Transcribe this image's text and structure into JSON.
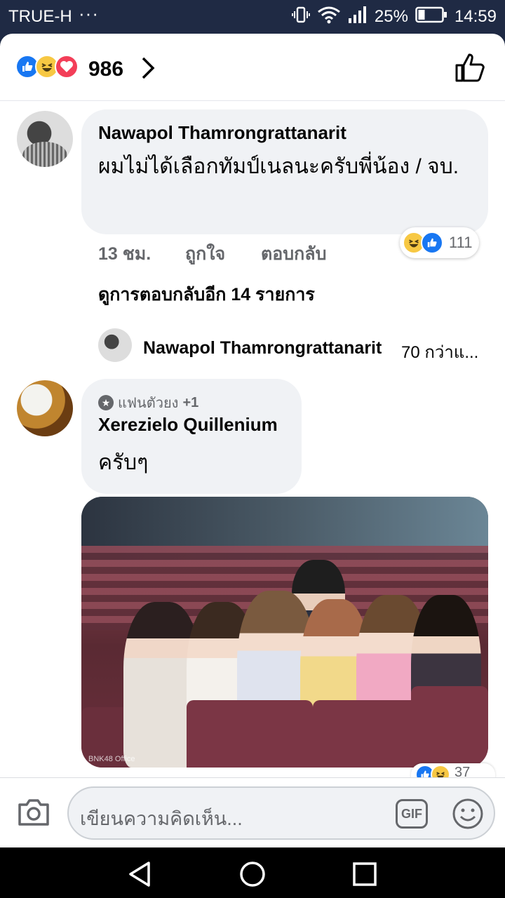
{
  "status_bar": {
    "carrier": "TRUE-H",
    "dots": "···",
    "battery": "25%",
    "time": "14:59"
  },
  "reactions_header": {
    "total": "986",
    "icons": [
      "like-icon",
      "haha-icon",
      "love-icon"
    ]
  },
  "comments": [
    {
      "author": "Nawapol Thamrongrattanarit",
      "text": "ผมไม่ได้เลือกทัมป์เนลนะครับพี่น้อง / จบ.",
      "time": "13 ชม.",
      "like_label": "ถูกใจ",
      "reply_label": "ตอบกลับ",
      "reaction_count": "111",
      "more_replies": "ดูการตอบกลับอีก 14 รายการ",
      "reply_preview": {
        "author": "Nawapol Thamrongrattanarit",
        "snippet": "70 กว่าแ..."
      }
    },
    {
      "badge": "แฟนตัวยง",
      "badge_plus": "+1",
      "author": "Xerezielo Quillenium",
      "text": "ครับๆ",
      "photo_watermark": "BNK48 Office",
      "reaction_count": "37"
    }
  ],
  "composer": {
    "placeholder": "เขียนความคิดเห็น...",
    "gif_label": "GIF"
  },
  "colors": {
    "accent": "#1877f2",
    "status_bar": "#1f2a44",
    "bubble": "#f0f2f5",
    "meta_text": "#65676b"
  }
}
